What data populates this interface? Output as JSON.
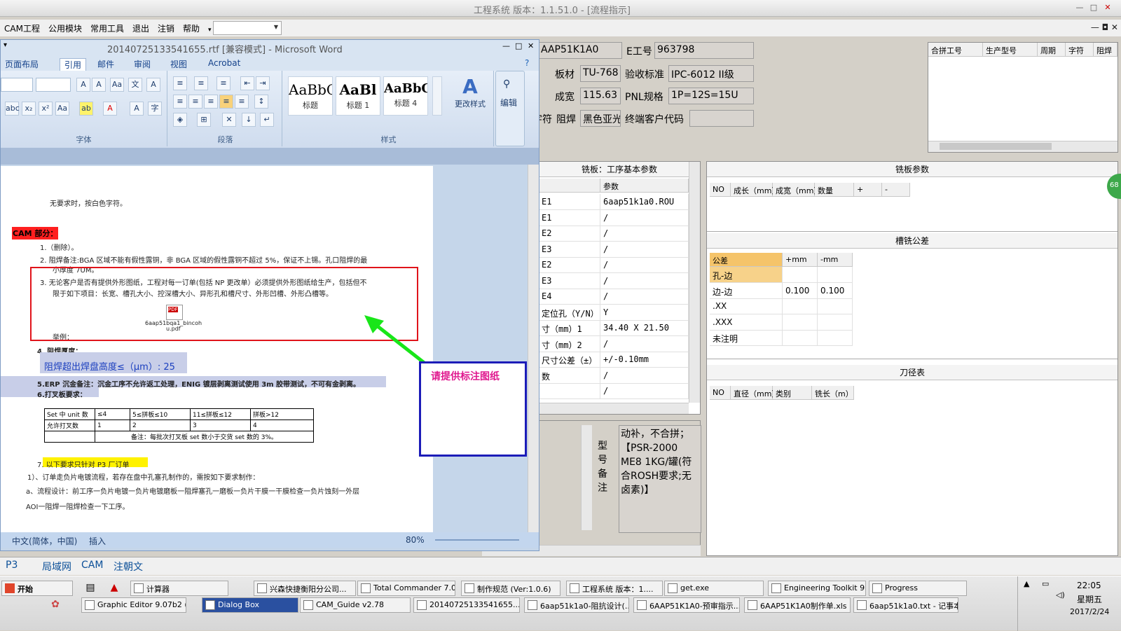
{
  "app": {
    "title": "工程系统    版本：1.1.51.0 - [流程指示]",
    "min": "—",
    "max": "□",
    "close": "✕",
    "menu": [
      "CAM工程",
      "公用模块",
      "常用工具",
      "退出",
      "注销",
      "帮助",
      "▾"
    ],
    "mdi": "—  ◘  ✕"
  },
  "info": {
    "job": "AAP51K1A0",
    "eno_label": "E工号",
    "eno": "963798",
    "board_label": "板材",
    "board": "TU-768",
    "std_label": "验收标准",
    "std": "IPC-6012 II级",
    "size_label": "成宽",
    "size": "115.63",
    "pnl_label": "PNL规格",
    "pnl": "1P=12S=15U",
    "char_label": "字符",
    "mask_label": "阻焊",
    "mask": "黑色亚光",
    "client_label": "终端客户代码",
    "client": ""
  },
  "merge_cols": [
    "合拼工号",
    "生产型号",
    "周期",
    "字符",
    "阻焊"
  ],
  "mill": {
    "title": "铣板：工序基本参数",
    "param_header": "参数",
    "rows": [
      {
        "k": "E1",
        "v": "6aap51k1a0.ROU"
      },
      {
        "k": "E1",
        "v": "/"
      },
      {
        "k": "E2",
        "v": "/"
      },
      {
        "k": "E3",
        "v": "/"
      },
      {
        "k": "E2",
        "v": "/"
      },
      {
        "k": "E3",
        "v": "/"
      },
      {
        "k": "E4",
        "v": "/"
      },
      {
        "k": "定位孔（Y/N）",
        "v": "Y"
      },
      {
        "k": "寸（mm）1",
        "v": "34.40 X 21.50"
      },
      {
        "k": "寸（mm）2",
        "v": "/"
      },
      {
        "k": "尺寸公差（±）",
        "v": "+/-0.10mm"
      },
      {
        "k": "数",
        "v": "/"
      },
      {
        "k": "",
        "v": "/"
      }
    ]
  },
  "mill_params": {
    "title": "铣板参数",
    "cols": [
      "NO",
      "成长（mm）",
      "成宽（mm）",
      "数量",
      "+",
      "-"
    ]
  },
  "slot": {
    "title": "槽铣公差",
    "cols": [
      "公差",
      "+mm",
      "-mm"
    ],
    "rows": [
      {
        "a": "孔-边",
        "b": "",
        "c": ""
      },
      {
        "a": "边-边",
        "b": "0.100",
        "c": "0.100"
      },
      {
        "a": ".XX",
        "b": "",
        "c": ""
      },
      {
        "a": ".XXX",
        "b": "",
        "c": ""
      },
      {
        "a": "未注明",
        "b": "",
        "c": ""
      }
    ]
  },
  "tool": {
    "title": "刀径表",
    "cols": [
      "NO",
      "直径（mm）",
      "类别",
      "铣长（m）"
    ]
  },
  "remark": {
    "label": "型号备注",
    "text": "动补，不合拼；【PSR-2000 ME8 1KG/罐(符合ROSH要求;无卤素)】"
  },
  "badge": "68",
  "word": {
    "title": "20140725133541655.rtf [兼容模式] - Microsoft Word",
    "tabs": [
      "页面布局",
      "引用",
      "邮件",
      "审阅",
      "视图",
      "Acrobat"
    ],
    "groups": [
      "字体",
      "段落",
      "样式",
      "编辑"
    ],
    "styles": [
      {
        "s": "AaBbC",
        "n": "标题"
      },
      {
        "s": "AaBl",
        "n": "标题 1"
      },
      {
        "s": "AaBbC",
        "n": "标题 4"
      }
    ],
    "change_style": "更改样式",
    "edit": "编辑",
    "status_lang": "中文(简体，中国)",
    "status_insert": "插入",
    "zoom": "80%"
  },
  "doc": {
    "l0": "无要求时，按白色字符。",
    "cam": "CAM 部分：",
    "i1": "1.（删除）。",
    "i2": "2. 阻焊备注:BGA 区域不能有假性露铜，非 BGA 区域的假性露铜不超过 5%，保证不上锡。孔口阻焊的最",
    "i2b": "小厚度 7UM。",
    "i3": "3. 无论客户是否有提供外形图纸，工程对每一订单(包括 NP 更改单）必须提供外形图纸给生产，包括但不",
    "i3b": "限于如下项目：长宽、槽孔大小、控深槽大小、异形孔和槽尺寸、外形凹槽、外形凸槽等。",
    "pdf": "6aap51bqa1_bincoh",
    "pdf2": "u.pdf",
    "ex": "举例：",
    "i4": "4. 阻焊厚度：",
    "i4b": "阻焊超出焊盘高度≤（μm）: 25",
    "i5": "5.ERP 沉金备注：沉金工序不允许返工处理，ENIG 镀层剥离测试使用 3m 胶带测试，不可有金剥离。",
    "i6": "6.打叉板要求：",
    "tbl": [
      [
        "Set 中 unit 数",
        "≤4",
        "5≤拼板≤10",
        "11≤拼板≤12",
        "拼板>12"
      ],
      [
        "允许打叉数",
        "1",
        "2",
        "3",
        "4"
      ]
    ],
    "tblnote": "备注：每批次打叉板 set 数小于交货 set 数的 3%。",
    "i7": "7.  以下要求只针对 P3 厂订单",
    "l1": "1）、订单走负片电镀流程，若存在盘中孔塞孔制作的，需按如下要求制作：",
    "la": "a、流程设计：前工序一负片电镀一负片电镀磨板一阻焊塞孔一磨板一负片干膜一干膜检查一负片蚀刻一外层",
    "lb": "AOI一阻焊一阻焊检查一下工序。"
  },
  "callout": "请提供标注图纸",
  "bottom_tabs": [
    "P3",
    "局域网",
    "CAM",
    "注朝文"
  ],
  "taskbar": {
    "start": "开始",
    "row1": [
      {
        "t": "计算器"
      },
      {
        "t": "兴森快捷衡阳分公司..."
      },
      {
        "t": "Total Commander 7.0 ..."
      },
      {
        "t": "制作规范 (Ver:1.0.6)"
      },
      {
        "t": "工程系统  版本：1...."
      },
      {
        "t": "get.exe"
      },
      {
        "t": "Engineering Toolkit 9...."
      },
      {
        "t": "Progress"
      }
    ],
    "row2": [
      {
        "t": "Graphic Editor 9.07b2 (0..."
      },
      {
        "t": "Dialog Box"
      },
      {
        "t": "CAM_Guide v2.78"
      },
      {
        "t": "20140725133541655..."
      },
      {
        "t": "6aap51k1a0-阻抗设计(..."
      },
      {
        "t": "6AAP51K1A0-预审指示...."
      },
      {
        "t": "6AAP51K1A0制作单.xls ..."
      },
      {
        "t": "6aap51k1a0.txt - 记事本"
      }
    ],
    "time": "22:05",
    "weekday": "星期五",
    "date": "2017/2/24"
  }
}
